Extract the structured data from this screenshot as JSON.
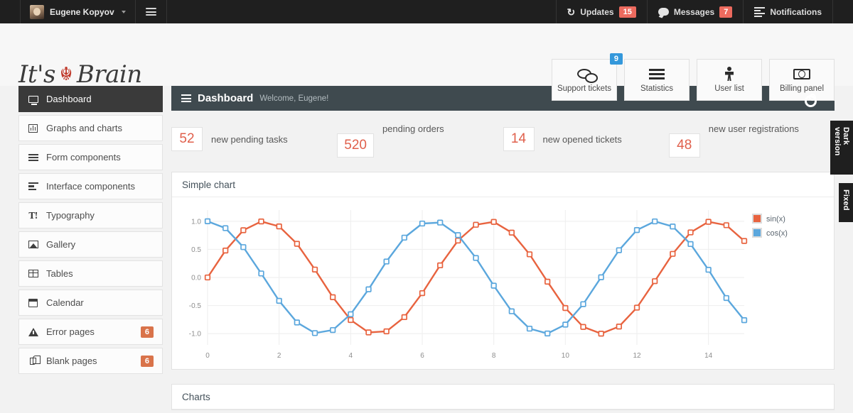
{
  "topbar": {
    "user_name": "Eugene Kopyov",
    "menu_icon": "hamburger-icon",
    "items": [
      {
        "label": "Updates",
        "badge": "15",
        "icon": "refresh-icon"
      },
      {
        "label": "Messages",
        "badge": "7",
        "icon": "chat-icon"
      },
      {
        "label": "Notifications",
        "badge": "",
        "icon": "list-icon"
      }
    ]
  },
  "header": {
    "logo_pre": "It's",
    "logo_knot": "☬",
    "logo_post": "Brain",
    "quick_buttons": [
      {
        "label": "Support tickets",
        "badge": "9",
        "icon": "chat-bubbles-icon"
      },
      {
        "label": "Statistics",
        "badge": "",
        "icon": "bars-icon"
      },
      {
        "label": "User list",
        "badge": "",
        "icon": "user-icon"
      },
      {
        "label": "Billing panel",
        "badge": "",
        "icon": "money-icon"
      }
    ]
  },
  "sidebar": {
    "items": [
      {
        "label": "Dashboard",
        "icon": "monitor-icon",
        "badge": "",
        "active": true
      },
      {
        "label": "Graphs and charts",
        "icon": "bar-chart-icon",
        "badge": "",
        "active": false
      },
      {
        "label": "Form components",
        "icon": "lines-icon",
        "badge": "",
        "active": false
      },
      {
        "label": "Interface components",
        "icon": "interface-icon",
        "badge": "",
        "active": false
      },
      {
        "label": "Typography",
        "icon": "typography-icon",
        "badge": "",
        "active": false
      },
      {
        "label": "Gallery",
        "icon": "image-icon",
        "badge": "",
        "active": false
      },
      {
        "label": "Tables",
        "icon": "table-icon",
        "badge": "",
        "active": false
      },
      {
        "label": "Calendar",
        "icon": "calendar-icon",
        "badge": "",
        "active": false
      },
      {
        "label": "Error pages",
        "icon": "warning-icon",
        "badge": "6",
        "active": false
      },
      {
        "label": "Blank pages",
        "icon": "copy-icon",
        "badge": "6",
        "active": false
      }
    ]
  },
  "content_header": {
    "title": "Dashboard",
    "subtitle": "Welcome, Eugene!",
    "menu_icon": "hamburger-icon",
    "settings_icon": "gears-icon"
  },
  "stats": [
    {
      "value": "52",
      "label": "new pending tasks"
    },
    {
      "value": "520",
      "label": "pending orders"
    },
    {
      "value": "14",
      "label": "new opened tickets"
    },
    {
      "value": "48",
      "label": "new user registrations"
    }
  ],
  "cards": [
    {
      "title": "Simple chart"
    },
    {
      "title": "Charts"
    }
  ],
  "right_tabs": [
    {
      "label": "Dark version"
    },
    {
      "label": "Fixed"
    }
  ],
  "colors": {
    "sin": "#e8633f",
    "cos": "#5ba7dd",
    "accent_red": "#ec6a5e",
    "accent_blue": "#3498db",
    "badge_orange": "#d9734a",
    "topbar_bg": "#1f1f1f",
    "panel_dark": "#3f4a4f"
  },
  "chart_data": {
    "type": "line",
    "title": "Simple chart",
    "xlabel": "",
    "ylabel": "",
    "xlim": [
      0,
      15
    ],
    "ylim": [
      -1.2,
      1.2
    ],
    "grid": true,
    "legend_position": "right",
    "xticks": [
      0,
      2,
      4,
      6,
      8,
      10,
      12,
      14
    ],
    "yticks": [
      1.0,
      0.5,
      0.0,
      -0.5,
      -1.0
    ],
    "ytick_labels": [
      "1.0",
      "0.5",
      "0.0",
      "-0.5",
      "-1.0"
    ],
    "x": [
      0,
      0.5,
      1,
      1.5,
      2,
      2.5,
      3,
      3.5,
      4,
      4.5,
      5,
      5.5,
      6,
      6.5,
      7,
      7.5,
      8,
      8.5,
      9,
      9.5,
      10,
      10.5,
      11,
      11.5,
      12,
      12.5,
      13,
      13.5,
      14,
      14.5,
      15
    ],
    "series": [
      {
        "name": "sin(x)",
        "color": "#e8633f",
        "values": [
          0,
          0.479,
          0.841,
          0.997,
          0.909,
          0.599,
          0.141,
          -0.351,
          -0.757,
          -0.978,
          -0.959,
          -0.706,
          -0.279,
          0.216,
          0.657,
          0.938,
          0.989,
          0.798,
          0.412,
          -0.075,
          -0.544,
          -0.88,
          -1,
          -0.874,
          -0.537,
          -0.066,
          0.42,
          0.802,
          0.991,
          0.93,
          0.65
        ]
      },
      {
        "name": "cos(x)",
        "color": "#5ba7dd",
        "values": [
          1,
          0.878,
          0.54,
          0.071,
          -0.416,
          -0.801,
          -0.99,
          -0.936,
          -0.654,
          -0.211,
          0.284,
          0.709,
          0.96,
          0.977,
          0.754,
          0.347,
          -0.146,
          -0.602,
          -0.911,
          -0.997,
          -0.839,
          -0.475,
          0.004,
          0.485,
          0.844,
          0.998,
          0.907,
          0.595,
          0.137,
          -0.366,
          -0.76
        ]
      }
    ]
  }
}
